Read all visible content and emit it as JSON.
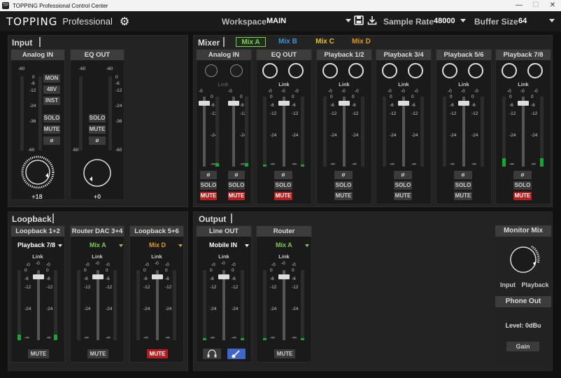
{
  "window": {
    "title": "TOPPING Professional Control Center",
    "app_icon": "TP",
    "minimize": "—",
    "maximize": "☐",
    "close": "✕"
  },
  "header": {
    "logo": "TOPPING",
    "logo_sub": "Professional",
    "workspace_label": "Workspace",
    "workspace_value": "MAIN",
    "sample_rate_label": "Sample Rate",
    "sample_rate_value": "48000",
    "buffer_label": "Buffer Size",
    "buffer_value": "64"
  },
  "input": {
    "title": "Input",
    "analog": {
      "label": "Analog IN",
      "scale_top": "-60",
      "scale": [
        "0",
        "-6",
        "-12",
        "-24",
        "-36",
        "-60"
      ],
      "mon": "MON",
      "p48": "48V",
      "inst": "INST",
      "solo": "SOLO",
      "mute": "MUTE",
      "phase": "ø",
      "gain": "+18"
    },
    "eq": {
      "label": "EQ OUT",
      "scale_top": "-60",
      "scale": [
        "0",
        "-6",
        "-12",
        "-24",
        "-36",
        "-60"
      ],
      "solo": "SOLO",
      "mute": "MUTE",
      "phase": "ø",
      "gain": "+0"
    }
  },
  "mixer": {
    "title": "Mixer",
    "tabs": [
      {
        "label": "Mix A",
        "color": "#7fcf4e"
      },
      {
        "label": "Mix B",
        "color": "#3e8fd8"
      },
      {
        "label": "Mix C",
        "color": "#e6c02a"
      },
      {
        "label": "Mix D",
        "color": "#e59a1a"
      }
    ],
    "channels": [
      {
        "label": "Analog IN",
        "link": "Link",
        "phase": "ø",
        "solo": "SOLO",
        "mute": "MUTE",
        "mute_active": true,
        "stereo_split": true,
        "level_a": 0.05,
        "level_b": 0.05
      },
      {
        "label": "EQ OUT",
        "link": "Link",
        "phase": "ø",
        "solo": "SOLO",
        "mute": "MUTE",
        "mute_active": true,
        "level_a": 0.03,
        "level_b": 0.03
      },
      {
        "label": "Playback 1/2",
        "link": "Link",
        "phase": "ø",
        "solo": "SOLO",
        "mute": "MUTE",
        "mute_active": false,
        "level_a": 0,
        "level_b": 0
      },
      {
        "label": "Playback 3/4",
        "link": "Link",
        "phase": "ø",
        "solo": "SOLO",
        "mute": "MUTE",
        "mute_active": false,
        "level_a": 0,
        "level_b": 0
      },
      {
        "label": "Playback 5/6",
        "link": "Link",
        "phase": "ø",
        "solo": "SOLO",
        "mute": "MUTE",
        "mute_active": false,
        "level_a": 0,
        "level_b": 0
      },
      {
        "label": "Playback 7/8",
        "link": "Link",
        "phase": "ø",
        "solo": "SOLO",
        "mute": "MUTE",
        "mute_active": true,
        "level_a": 0.12,
        "level_b": 0.12
      }
    ],
    "fader_scale": [
      "0",
      "-6",
      "-12",
      "-24",
      "-∞"
    ],
    "fader_top": "-0"
  },
  "loopback": {
    "title": "Loopback",
    "channels": [
      {
        "label": "Loopback 1+2",
        "source": "Playback 7/8",
        "source_color": "#ffffff",
        "link": "Link",
        "mute": "MUTE",
        "mute_active": false,
        "level_a": 0.08,
        "level_b": 0.08
      },
      {
        "label": "Router DAC 3+4",
        "source": "Mix A",
        "source_color": "#7fcf4e",
        "link": "Link",
        "mute": "MUTE",
        "mute_active": false,
        "level_a": 0,
        "level_b": 0
      },
      {
        "label": "Loopback 5+6",
        "source": "Mix D",
        "source_color": "#e59a1a",
        "link": "Link",
        "mute": "MUTE",
        "mute_active": true,
        "level_a": 0,
        "level_b": 0
      }
    ]
  },
  "output": {
    "title": "Output",
    "line": {
      "label": "Line OUT",
      "source": "Mobile IN",
      "link": "Link",
      "level_a": 0.03,
      "level_b": 0.03
    },
    "router": {
      "label": "Router",
      "source": "Mix A",
      "source_color": "#7fcf4e",
      "link": "Link",
      "mute": "MUTE",
      "level_a": 0.03,
      "level_b": 0.03
    }
  },
  "monitor": {
    "label": "Monitor Mix",
    "left": "Input",
    "right": "Playback",
    "phone": "Phone Out",
    "level_label": "Level: 0dBu",
    "gain": "Gain"
  }
}
